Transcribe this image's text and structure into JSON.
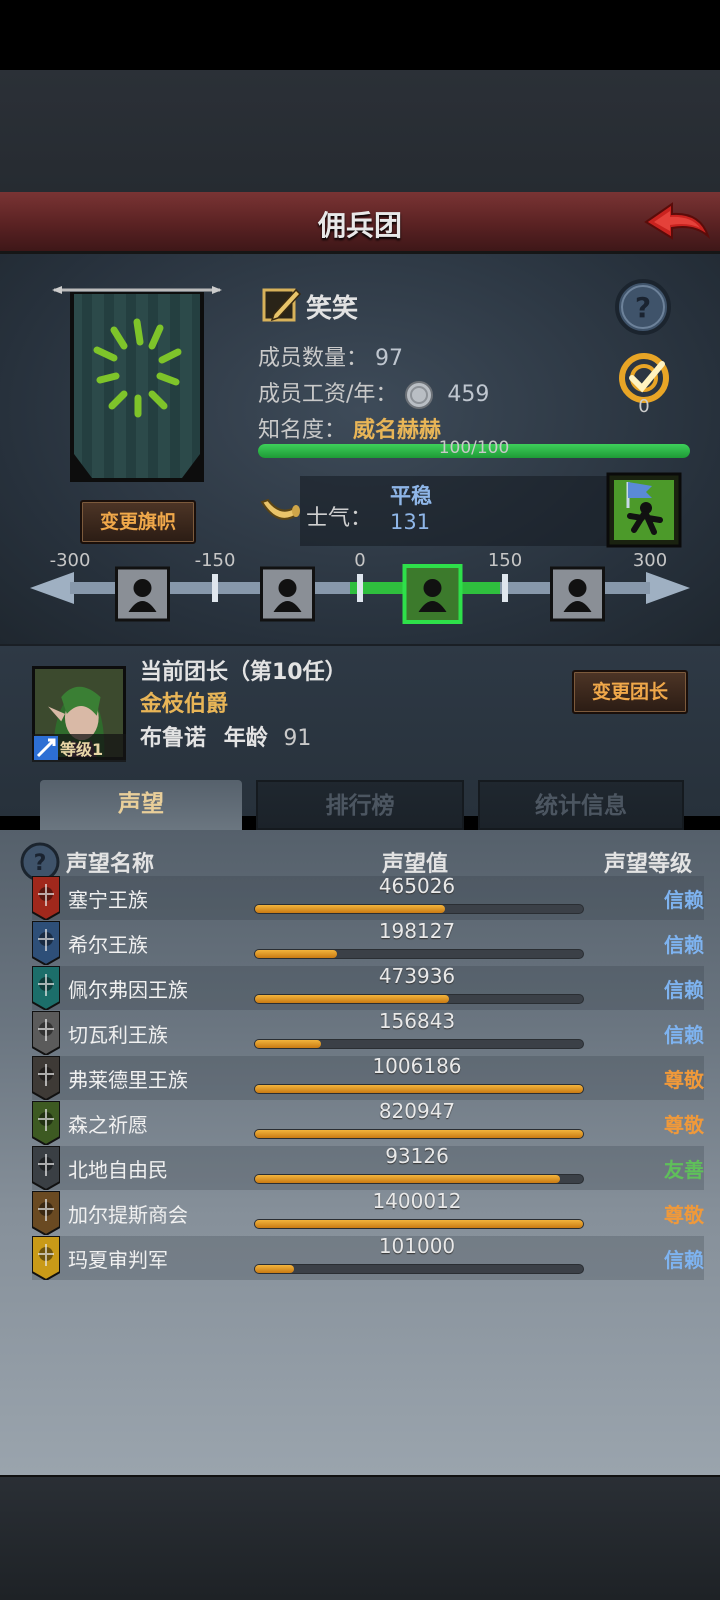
{
  "header": {
    "title": "佣兵团"
  },
  "guild": {
    "name": "笑笑",
    "members_label": "成员数量：",
    "members_value": "97",
    "salary_label": "成员工资/年：",
    "salary_value": "459",
    "fame_label": "知名度：",
    "fame_rank": "威名赫赫",
    "fame_progress": "100/100",
    "fame_fraction": 1.0,
    "target_count": "0",
    "change_banner_label": "变更旗帜"
  },
  "morale": {
    "label": "士气：",
    "state": "平稳",
    "value": "131",
    "scale_ticks": [
      "-300",
      "-150",
      "0",
      "150",
      "300"
    ],
    "scale_min": -300,
    "scale_max": 300
  },
  "leader": {
    "title": "当前团长（第10任）",
    "noble_title": "金枝伯爵",
    "name": "布鲁诺",
    "age_label": "年龄",
    "age": "91",
    "level_label": "等级1",
    "change_leader_label": "变更团长"
  },
  "tabs": [
    {
      "label": "声望",
      "active": true
    },
    {
      "label": "排行榜",
      "active": false
    },
    {
      "label": "统计信息",
      "active": false
    }
  ],
  "reputation": {
    "headers": {
      "name": "声望名称",
      "value": "声望值",
      "level": "声望等级"
    },
    "rows": [
      {
        "name": "塞宁王族",
        "value": "465026",
        "fill": 0.58,
        "level": "信赖",
        "level_color": "#7eb3f0",
        "icon": "red-tree-crest-icon",
        "icon_color": "#a0281c"
      },
      {
        "name": "希尔王族",
        "value": "198127",
        "fill": 0.25,
        "level": "信赖",
        "level_color": "#7eb3f0",
        "icon": "blue-arch-crest-icon",
        "icon_color": "#2e4f78"
      },
      {
        "name": "佩尔弗因王族",
        "value": "473936",
        "fill": 0.59,
        "level": "信赖",
        "level_color": "#7eb3f0",
        "icon": "teal-wave-crest-icon",
        "icon_color": "#1c6e6a"
      },
      {
        "name": "切瓦利王族",
        "value": "156843",
        "fill": 0.2,
        "level": "信赖",
        "level_color": "#7eb3f0",
        "icon": "scales-crest-icon",
        "icon_color": "#5b5b5b"
      },
      {
        "name": "弗莱德里王族",
        "value": "1006186",
        "fill": 1.0,
        "level": "尊敬",
        "level_color": "#f0993a",
        "icon": "horse-crest-icon",
        "icon_color": "#3e3a36"
      },
      {
        "name": "森之祈愿",
        "value": "820947",
        "fill": 1.0,
        "level": "尊敬",
        "level_color": "#f0993a",
        "icon": "tree-crest-icon",
        "icon_color": "#3d5a22"
      },
      {
        "name": "北地自由民",
        "value": "93126",
        "fill": 0.93,
        "level": "友善",
        "level_color": "#5fc05a",
        "icon": "skull-crest-icon",
        "icon_color": "#3a3f44"
      },
      {
        "name": "加尔提斯商会",
        "value": "1400012",
        "fill": 1.0,
        "level": "尊敬",
        "level_color": "#f0993a",
        "icon": "chest-crest-icon",
        "icon_color": "#6a4a22"
      },
      {
        "name": "玛夏审判军",
        "value": "101000",
        "fill": 0.12,
        "level": "信赖",
        "level_color": "#7eb3f0",
        "icon": "gold-cross-crest-icon",
        "icon_color": "#c99a18"
      }
    ]
  }
}
